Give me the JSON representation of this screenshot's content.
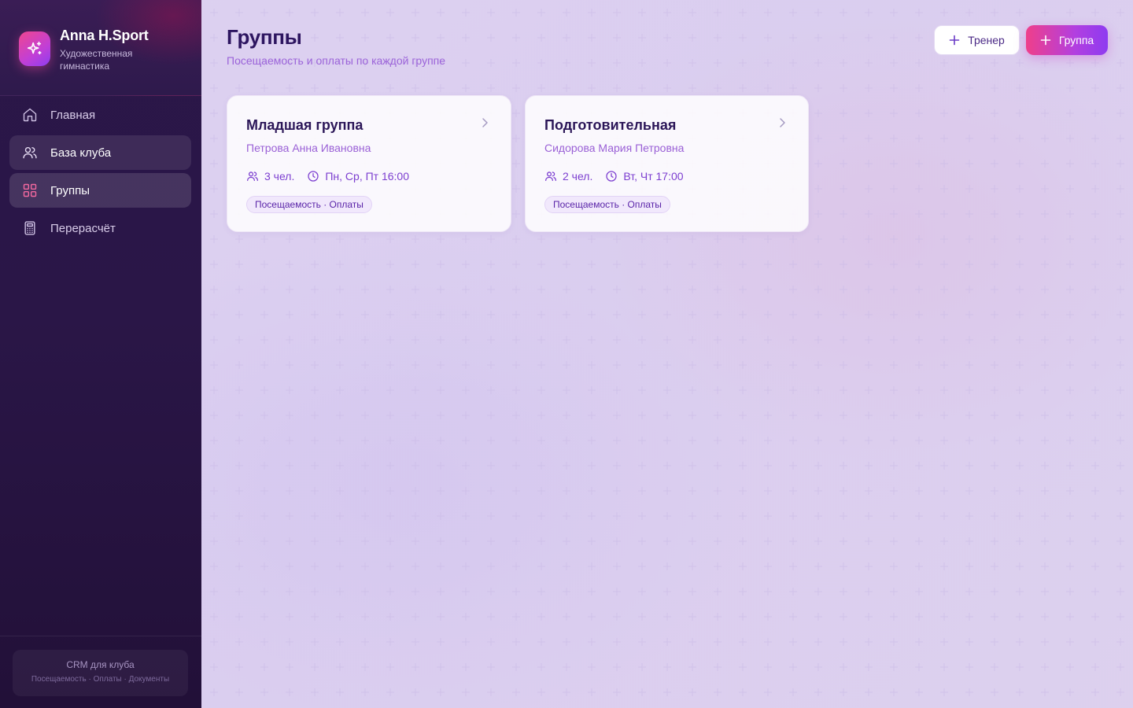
{
  "brand": {
    "name": "Anna H.Sport",
    "subtitle": "Художественная гимнастика",
    "logo_icon": "sparkles-icon"
  },
  "sidebar": {
    "items": [
      {
        "label": "Главная",
        "icon": "home-icon",
        "state": "default"
      },
      {
        "label": "База клуба",
        "icon": "users-icon",
        "state": "hover"
      },
      {
        "label": "Группы",
        "icon": "grid-icon",
        "state": "active"
      },
      {
        "label": "Перерасчёт",
        "icon": "calculator-icon",
        "state": "default"
      }
    ],
    "footer": {
      "title": "CRM для клуба",
      "subtitle": "Посещаемость · Оплаты · Документы"
    }
  },
  "header": {
    "title": "Группы",
    "subtitle": "Посещаемость и оплаты по каждой группе",
    "buttons": {
      "trainer_label": "Тренер",
      "group_label": "Группа"
    }
  },
  "groups": [
    {
      "title": "Младшая группа",
      "trainer": "Петрова Анна Ивановна",
      "members": "3 чел.",
      "schedule": "Пн, Ср, Пт 16:00",
      "badge": "Посещаемость · Оплаты"
    },
    {
      "title": "Подготовительная",
      "trainer": "Сидорова Мария Петровна",
      "members": "2 чел.",
      "schedule": "Вт, Чт 17:00",
      "badge": "Посещаемость · Оплаты"
    }
  ],
  "colors": {
    "sidebar_bg": "#2a1647",
    "accent_pink": "#ef3f8a",
    "accent_purple": "#8e3bf0",
    "title_text": "#2d1560",
    "muted_purple": "#9b63d9"
  }
}
